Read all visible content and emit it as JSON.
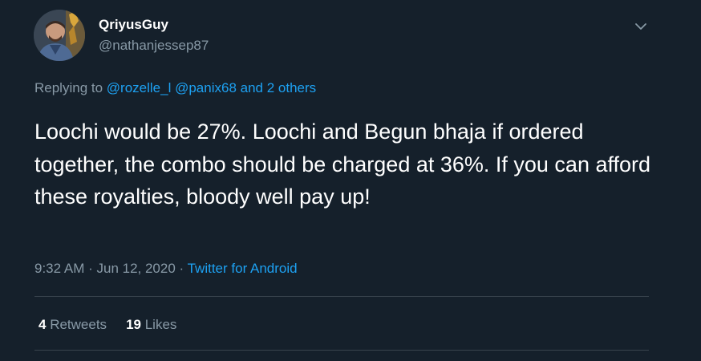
{
  "tweet": {
    "display_name": "QriyusGuy",
    "handle": "@nathanjessep87",
    "replying_prefix": "Replying to ",
    "mention_1": "@rozelle_l",
    "mention_2": "@panix68",
    "mention_joiner": " and ",
    "others": "2 others",
    "text": "Loochi would be 27%. Loochi and Begun bhaja if ordered together, the combo should be charged at 36%. If you can afford these royalties, bloody well pay up!",
    "time": "9:32 AM",
    "date": "Jun 12, 2020",
    "separator": " · ",
    "source": "Twitter for Android",
    "retweets_count": "4",
    "retweets_label": " Retweets",
    "likes_count": "19",
    "likes_label": " Likes"
  },
  "icons": {
    "avatar": "profile-photo",
    "menu": "chevron-down-icon"
  },
  "colors": {
    "background": "#15202b",
    "secondary_text": "#8899a6",
    "accent": "#1da1f2",
    "divider": "#38444d"
  }
}
